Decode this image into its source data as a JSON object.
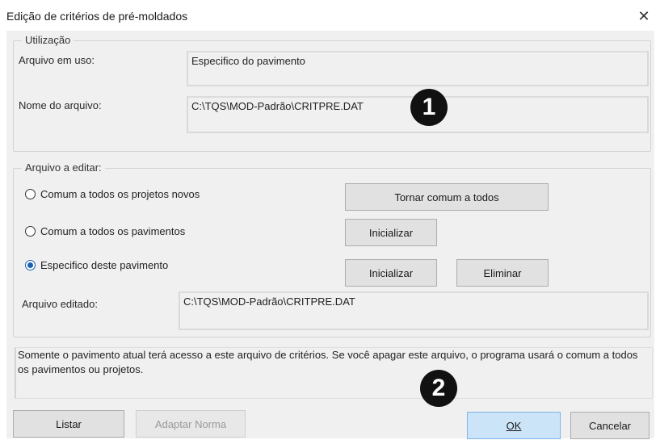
{
  "window": {
    "title": "Edição de critérios de pré-moldados",
    "close_glyph": "✕"
  },
  "utilizacao": {
    "legend": "Utilização",
    "arquivo_em_uso_label": "Arquivo em uso:",
    "arquivo_em_uso_value": "Especifico do pavimento",
    "nome_do_arquivo_label": "Nome do arquivo:",
    "nome_do_arquivo_value": "C:\\TQS\\MOD-Padrão\\CRITPRE.DAT"
  },
  "arquivo_a_editar": {
    "legend": "Arquivo a editar:",
    "options": [
      {
        "label": "Comum a todos os projetos novos",
        "selected": false
      },
      {
        "label": "Comum a todos os pavimentos",
        "selected": false
      },
      {
        "label": "Especifico deste pavimento",
        "selected": true
      }
    ],
    "tornar_comum_label": "Tornar comum a todos",
    "inicializar_label_1": "Inicializar",
    "inicializar_label_2": "Inicializar",
    "eliminar_label": "Eliminar",
    "arquivo_editado_label": "Arquivo editado:",
    "arquivo_editado_value": "C:\\TQS\\MOD-Padrão\\CRITPRE.DAT"
  },
  "info_text": "Somente o pavimento atual terá acesso a este arquivo de critérios. Se você apagar este arquivo, o programa usará o comum a todos os pavimentos ou projetos.",
  "footer": {
    "listar_label": "Listar",
    "adaptar_norma_label": "Adaptar Norma",
    "ok_label": "OK",
    "cancelar_label": "Cancelar"
  },
  "callouts": {
    "one": "1",
    "two": "2"
  }
}
